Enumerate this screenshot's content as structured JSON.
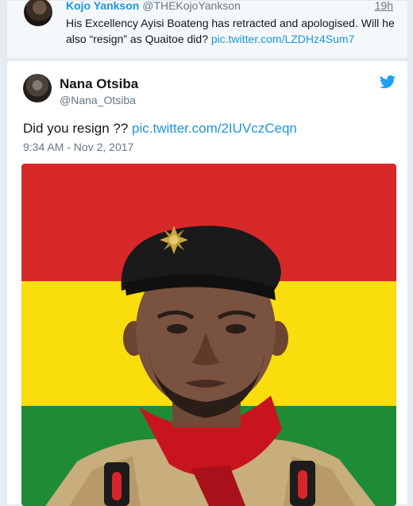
{
  "reply": {
    "name": "Kojo Yankson",
    "handle": "@THEKojoYankson",
    "time": "19h",
    "text": "His Excellency Ayisi Boateng has retracted and apologised. Will he also “resign” as Quaitoe did? ",
    "link": "pic.twitter.com/LZDHz4Sum7"
  },
  "tweet": {
    "name": "Nana Otsiba",
    "handle": "@Nana_Otsiba",
    "text": "Did you resign ?? ",
    "link": "pic.twitter.com/2IUVczCeqn",
    "timestamp": "9:34 AM - Nov 2, 2017"
  },
  "image": {
    "flag_colors": {
      "red": "#d7282a",
      "yellow": "#f9dd0c",
      "green": "#1f8b36"
    },
    "accent": "#1b95e0"
  }
}
